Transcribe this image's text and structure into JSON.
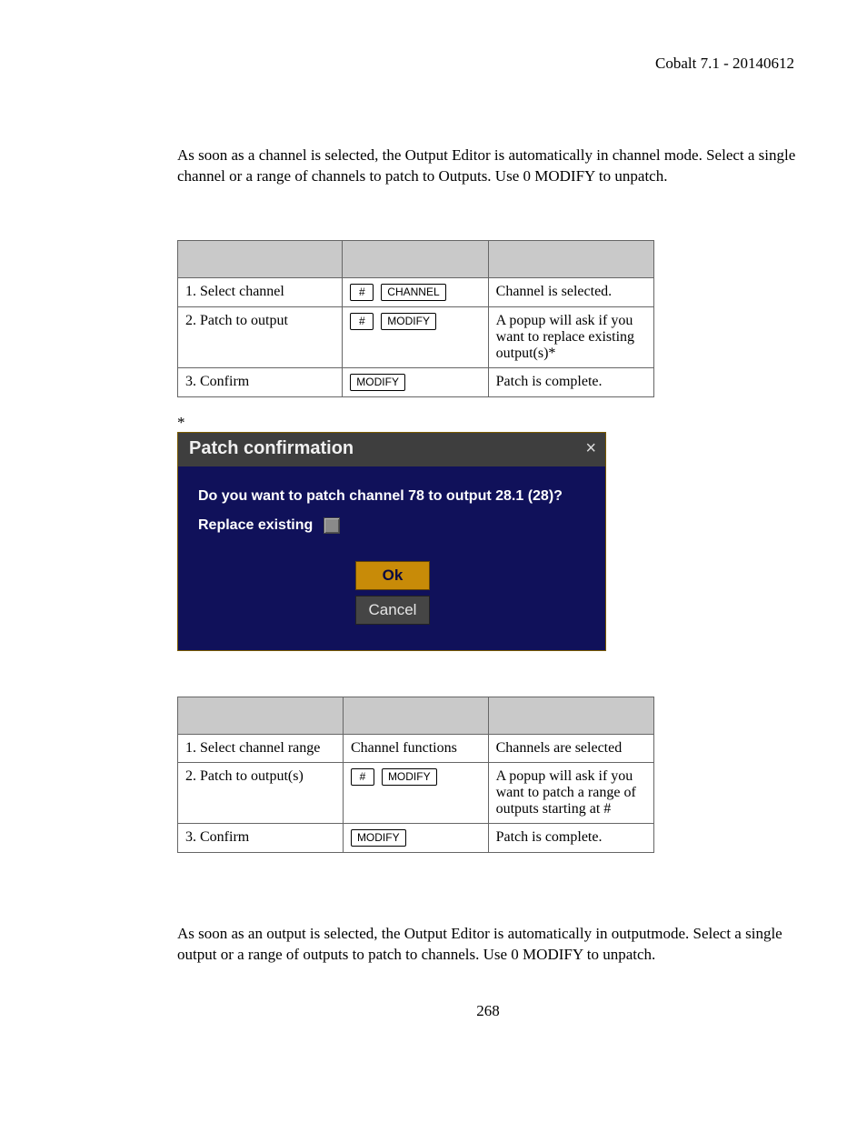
{
  "header": {
    "text": "Cobalt 7.1 - 20140612"
  },
  "intro1": "As soon as a channel is selected, the Output Editor is automatically in channel mode. Select a single channel or a range of channels to patch to Outputs. Use 0 MODIFY to unpatch.",
  "table1": {
    "rows": [
      {
        "step": "1. Select channel",
        "keys": [
          "#",
          "CHANNEL"
        ],
        "result": "Channel is selected."
      },
      {
        "step": "2. Patch to output",
        "keys": [
          "#",
          "MODIFY"
        ],
        "result": "A popup will ask if you want to replace existing output(s)*"
      },
      {
        "step": "3. Confirm",
        "keys": [
          "MODIFY"
        ],
        "result": "Patch is complete."
      }
    ]
  },
  "asterisk": "*",
  "dialog": {
    "title": "Patch confirmation",
    "close": "×",
    "question": "Do you want to patch channel 78 to output 28.1 (28)?",
    "replace_label": "Replace existing",
    "ok": "Ok",
    "cancel": "Cancel"
  },
  "table2": {
    "rows": [
      {
        "step": "1. Select channel range",
        "text": "Channel functions",
        "result": "Channels are selected"
      },
      {
        "step": "2. Patch to output(s)",
        "keys": [
          "#",
          "MODIFY"
        ],
        "result": "A popup will ask if you want to patch a range of outputs starting at #"
      },
      {
        "step": "3. Confirm",
        "keys": [
          "MODIFY"
        ],
        "result": "Patch is complete."
      }
    ]
  },
  "intro2": "As soon as an output is selected, the Output Editor is automatically in outputmode. Select a single output or a range of outputs to patch to channels. Use 0 MODIFY to unpatch.",
  "pagenum": "268"
}
